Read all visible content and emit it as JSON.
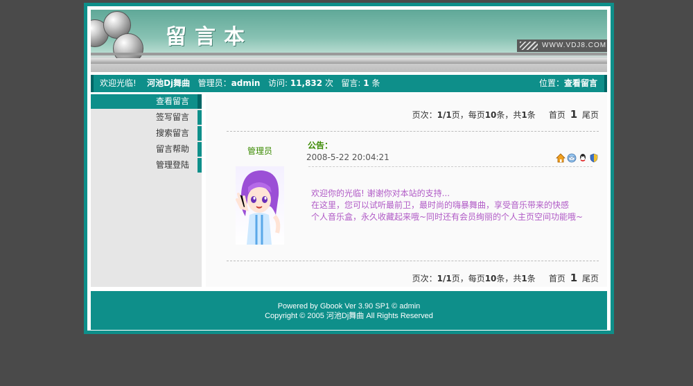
{
  "banner": {
    "title": "留言本",
    "url": "WWW.VDJ8.COM"
  },
  "infobar": {
    "welcome": "欢迎光临!",
    "site_name": "河池Dj舞曲",
    "admin_label": "管理员：",
    "admin_name": "admin",
    "visits_label": "访问:",
    "visits_value": "11,832",
    "visits_unit": "次",
    "messages_label": "留言:",
    "messages_value": "1",
    "messages_unit": "条",
    "location_label": "位置：",
    "location_value": "查看留言"
  },
  "sidebar": {
    "items": [
      {
        "label": "查看留言"
      },
      {
        "label": "签写留言"
      },
      {
        "label": "搜索留言"
      },
      {
        "label": "留言帮助"
      },
      {
        "label": "管理登陆"
      }
    ]
  },
  "pager": {
    "pages_label": "页次：",
    "pages_value": "1/1",
    "pages_unit": "页，每页",
    "per_page": "10",
    "per_page_unit": "条，共",
    "total": "1",
    "total_unit": "条",
    "first": "首页",
    "current": "1",
    "last": "尾页"
  },
  "post": {
    "author": "管理员",
    "title": "公告：",
    "date": "2008-5-22 20:04:21",
    "lines": [
      "欢迎你的光临! 谢谢你对本站的支持...",
      "在这里，您可以试听最前卫，最时尚的嗨暴舞曲，享受音乐带来的快感",
      "个人音乐盒，永久收藏起来哦~同时还有会员绚丽的个人主页空间功能哦~"
    ]
  },
  "footer": {
    "line1": "Powered by Gbook Ver 3.90 SP1 © admin",
    "line2": "Copyright © 2005 河池Dj舞曲  All Rights Reserved"
  }
}
